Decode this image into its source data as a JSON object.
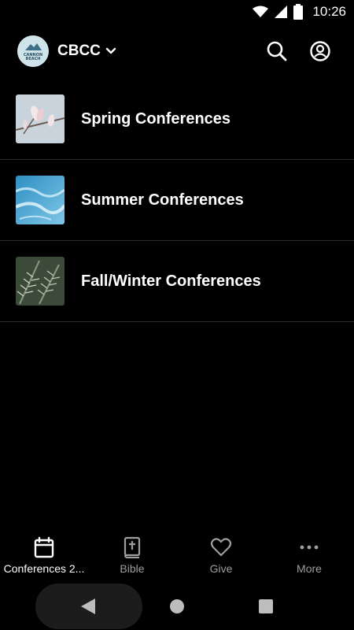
{
  "status_bar": {
    "time": "10:26",
    "icons": [
      "wifi-icon",
      "cell-signal-icon",
      "battery-icon"
    ]
  },
  "header": {
    "org_name": "CBCC",
    "logo_text": [
      "CANNON",
      "BEACH"
    ],
    "icons": [
      "chevron-down-icon",
      "search-icon",
      "profile-icon"
    ]
  },
  "conferences": [
    {
      "label": "Spring Conferences",
      "thumb": "magnolia-blossoms"
    },
    {
      "label": "Summer Conferences",
      "thumb": "blue-water"
    },
    {
      "label": "Fall/Winter Conferences",
      "thumb": "evergreen-branches"
    }
  ],
  "tabs": [
    {
      "label": "Conferences 2...",
      "icon": "calendar-icon",
      "active": true
    },
    {
      "label": "Bible",
      "icon": "bible-icon",
      "active": false
    },
    {
      "label": "Give",
      "icon": "heart-icon",
      "active": false
    },
    {
      "label": "More",
      "icon": "more-dots-icon",
      "active": false
    }
  ],
  "colors": {
    "background": "#000000",
    "text": "#ffffff",
    "inactive_tab": "#9e9e9e",
    "divider": "#2b2b2b"
  }
}
